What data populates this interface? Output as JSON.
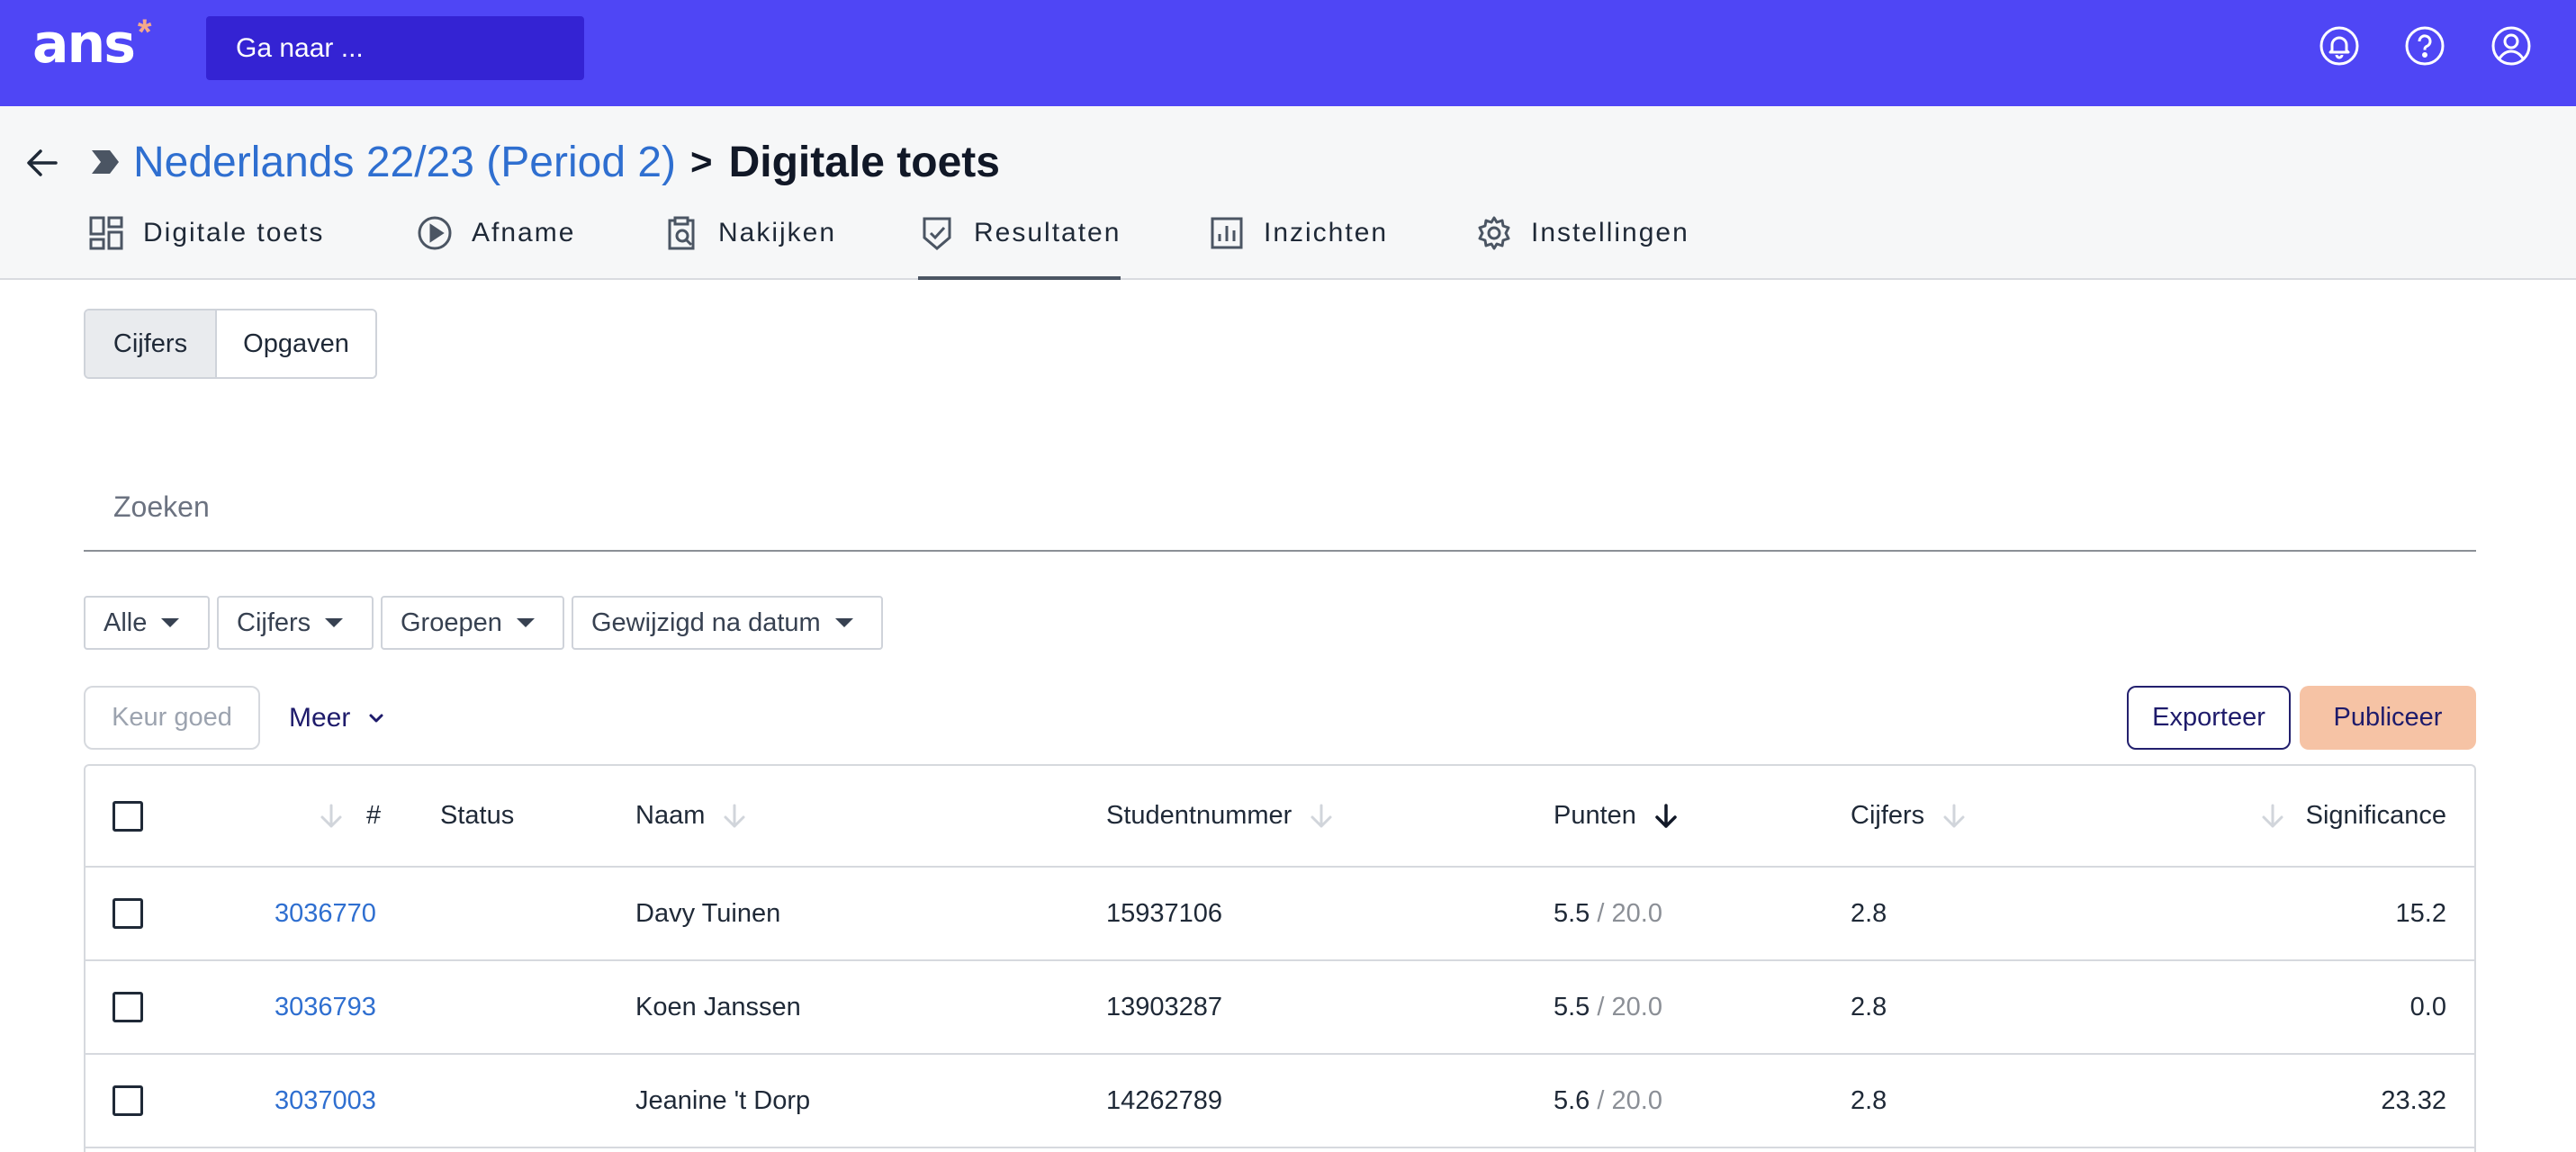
{
  "topbar": {
    "logo_text": "ans",
    "logo_mark": "*",
    "goto_placeholder": "Ga naar ...",
    "icons": [
      "notification-bell-icon",
      "help-question-icon",
      "user-account-icon"
    ],
    "colors": {
      "bar": "#4f46f5",
      "goto": "#3423d3",
      "logo_mark": "#f4a98a"
    }
  },
  "breadcrumb": {
    "course": "Nederlands 22/23 (Period 2)",
    "separator": ">",
    "current": "Digitale toets"
  },
  "tabs": [
    {
      "label": "Digitale toets",
      "icon": "dashboard-grid-icon",
      "active": false
    },
    {
      "label": "Afname",
      "icon": "play-circle-icon",
      "active": false
    },
    {
      "label": "Nakijken",
      "icon": "clipboard-search-icon",
      "active": false
    },
    {
      "label": "Resultaten",
      "icon": "shield-check-icon",
      "active": true
    },
    {
      "label": "Inzichten",
      "icon": "bar-chart-icon",
      "active": false
    },
    {
      "label": "Instellingen",
      "icon": "gear-icon",
      "active": false
    }
  ],
  "segment": {
    "options": [
      "Cijfers",
      "Opgaven"
    ],
    "selected": "Cijfers"
  },
  "search": {
    "placeholder": "Zoeken",
    "value": ""
  },
  "filters": [
    "Alle",
    "Cijfers",
    "Groepen",
    "Gewijzigd na datum"
  ],
  "actions": {
    "approve": "Keur goed",
    "more": "Meer",
    "export": "Exporteer",
    "publish": "Publiceer",
    "colors": {
      "publish_bg": "#f6c3a5",
      "primary_text": "#1e1b6b"
    }
  },
  "table": {
    "columns": {
      "number": "#",
      "status": "Status",
      "name": "Naam",
      "student_number": "Studentnummer",
      "points": "Punten",
      "grades": "Cijfers",
      "significance": "Significance"
    },
    "sorted_by": "Punten",
    "rows": [
      {
        "id": "3036770",
        "status": "",
        "name": "Davy Tuinen",
        "student_number": "15937106",
        "points": "5.5",
        "points_max": " / 20.0",
        "grade": "2.8",
        "significance": "15.2"
      },
      {
        "id": "3036793",
        "status": "",
        "name": "Koen Janssen",
        "student_number": "13903287",
        "points": "5.5",
        "points_max": " / 20.0",
        "grade": "2.8",
        "significance": "0.0"
      },
      {
        "id": "3037003",
        "status": "",
        "name": "Jeanine 't Dorp",
        "student_number": "14262789",
        "points": "5.6",
        "points_max": " / 20.0",
        "grade": "2.8",
        "significance": "23.32"
      }
    ]
  }
}
